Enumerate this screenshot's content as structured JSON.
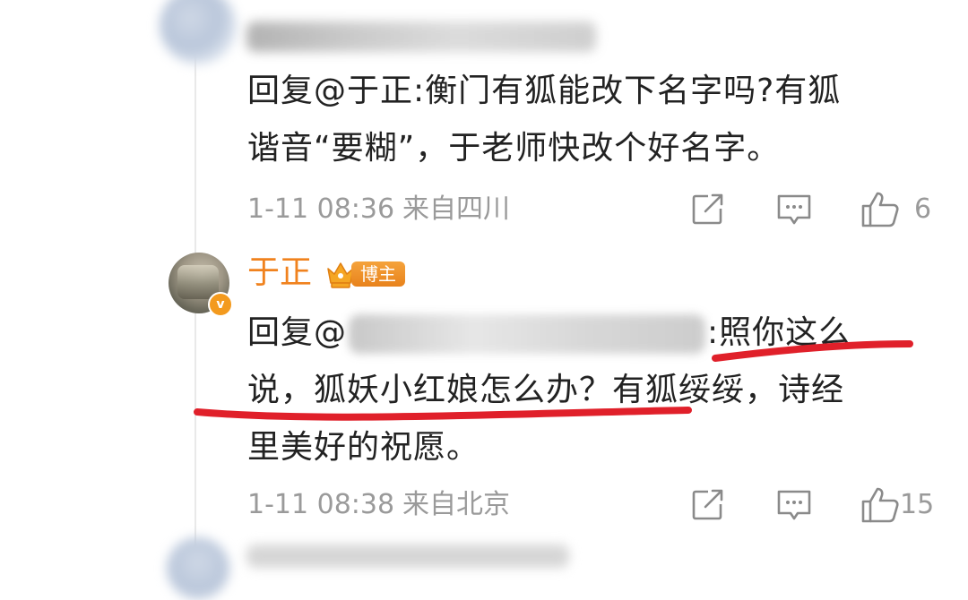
{
  "comment1": {
    "reply_prefix": "回复",
    "mention": "@于正",
    "body_line1": ":衡门有狐能改下名字吗?有狐",
    "body_line2": "谐音“要糊”，于老师快改个好名字。",
    "time": "1-11 08:36",
    "location": "来自四川",
    "likes": "6"
  },
  "comment2": {
    "author": "于正",
    "badge": "博主",
    "reply_prefix": "回复",
    "mention_prefix": "@",
    "body_line1": ":照你这么",
    "body_line2": "说，狐妖小红娘怎么办？有狐绥绥，诗经",
    "body_line3": "里美好的祝愿。",
    "time": "1-11 08:38",
    "location": "来自北京",
    "likes": "15"
  },
  "icons": {
    "share": "share-icon",
    "reply": "comment-icon",
    "like": "thumbs-up-icon",
    "verified": "verified-v-icon",
    "crown": "crown-icon"
  },
  "colors": {
    "author_name": "#f0821e",
    "badge": "#e8821b",
    "meta_text": "#9a9a9a",
    "underline": "#e0202a"
  }
}
